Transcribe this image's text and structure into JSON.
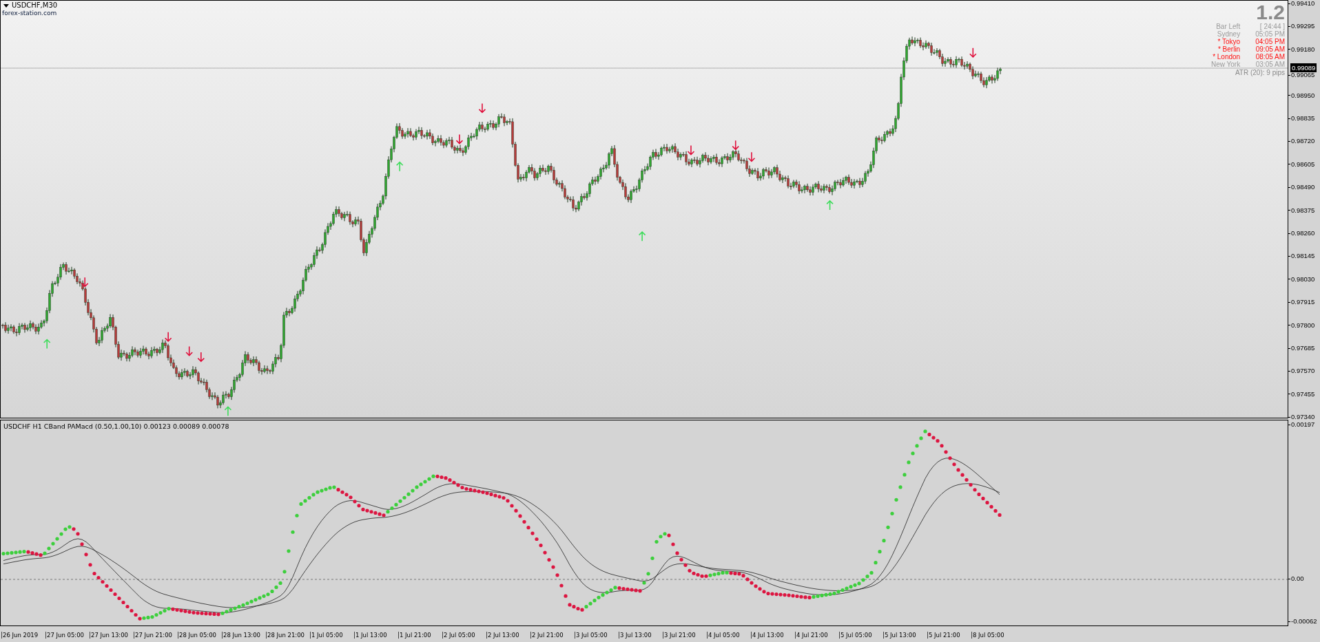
{
  "chart": {
    "title": "USDCHF,M30",
    "source": "forex-station.com"
  },
  "info_panel": {
    "version": "1.2",
    "rows": [
      {
        "label": "Bar Left",
        "value": "[ 24:44 ]",
        "highlighted": false
      },
      {
        "label": "Sydney",
        "value": "05:05 PM",
        "highlighted": false
      },
      {
        "label": "* Tokyo",
        "value": "04:05 PM",
        "highlighted": true
      },
      {
        "label": "* Berlin",
        "value": "09:05 AM",
        "highlighted": true
      },
      {
        "label": "* London",
        "value": "08:05 AM",
        "highlighted": true
      },
      {
        "label": "New York",
        "value": "03:05 AM",
        "highlighted": false
      }
    ],
    "atr": "ATR (20): 9 pips"
  },
  "price_axis": {
    "ticks": [
      "0.99410",
      "0.99295",
      "0.99180",
      "0.99065",
      "0.98950",
      "0.98835",
      "0.98720",
      "0.98605",
      "0.98490",
      "0.98375",
      "0.98260",
      "0.98145",
      "0.98030",
      "0.97915",
      "0.97800",
      "0.97685",
      "0.97570",
      "0.97455",
      "0.97340"
    ],
    "current_price": "0.99089"
  },
  "indicator": {
    "title": "USDCHF H1 CBand PAMacd (0.50,1.00,10) 0.00123 0.00089 0.00078",
    "axis_ticks": [
      "0.00197",
      "0.00",
      "-0.00062"
    ]
  },
  "time_axis": {
    "labels": [
      "26 Jun 2019",
      "27 Jun 05:00",
      "27 Jun 13:00",
      "27 Jun 21:00",
      "28 Jun 05:00",
      "28 Jun 13:00",
      "28 Jun 21:00",
      "1 Jul 05:00",
      "1 Jul 13:00",
      "1 Jul 21:00",
      "2 Jul 05:00",
      "2 Jul 13:00",
      "2 Jul 21:00",
      "3 Jul 05:00",
      "3 Jul 13:00",
      "3 Jul 21:00",
      "4 Jul 05:00",
      "4 Jul 13:00",
      "4 Jul 21:00",
      "5 Jul 05:00",
      "5 Jul 13:00",
      "5 Jul 21:00",
      "8 Jul 05:00"
    ]
  }
}
